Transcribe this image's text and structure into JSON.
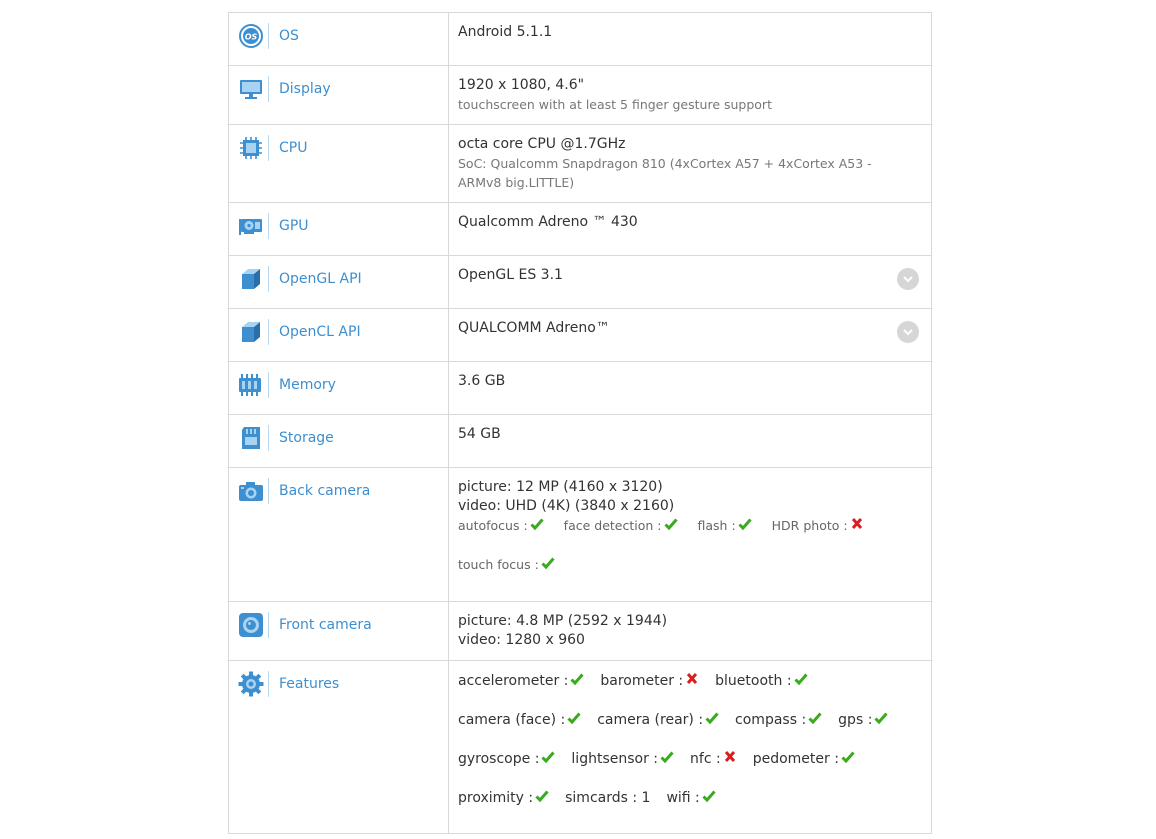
{
  "colors": {
    "label": "#3d8fd0",
    "check": "#3aaa1e",
    "cross": "#d81e1e",
    "border": "#d9d9d9"
  },
  "rows": [
    {
      "label": "OS",
      "icon": "os-icon",
      "main": [
        "Android 5.1.1"
      ]
    },
    {
      "label": "Display",
      "icon": "monitor-icon",
      "main": [
        "1920 x 1080, 4.6\""
      ],
      "sub": "touchscreen with at least 5 finger gesture support"
    },
    {
      "label": "CPU",
      "icon": "chip-icon",
      "main": [
        "octa core CPU @1.7GHz"
      ],
      "sub": "SoC: Qualcomm Snapdragon 810 (4xCortex A57 + 4xCortex A53 - ARMv8 big.LITTLE)"
    },
    {
      "label": "GPU",
      "icon": "gpu-card-icon",
      "main": [
        "Qualcomm Adreno ™ 430"
      ]
    },
    {
      "label": "OpenGL API",
      "icon": "cube-icon",
      "main": [
        "OpenGL ES 3.1"
      ]
    },
    {
      "label": "OpenCL API",
      "icon": "cube-icon",
      "main": [
        "QUALCOMM Adreno™"
      ]
    },
    {
      "label": "Memory",
      "icon": "ram-icon",
      "main": [
        "3.6 GB"
      ]
    },
    {
      "label": "Storage",
      "icon": "sd-card-icon",
      "main": [
        "54 GB"
      ]
    },
    {
      "label": "Back camera",
      "icon": "camera-icon",
      "main": [
        "picture: 12 MP (4160 x 3120)",
        "video: UHD (4K) (3840 x 2160)"
      ],
      "flags": [
        [
          {
            "name": "autofocus :",
            "ok": true
          },
          {
            "name": "face detection :",
            "ok": true
          },
          {
            "name": "flash :",
            "ok": true
          },
          {
            "name": "HDR photo :",
            "ok": false
          }
        ],
        [
          {
            "name": "touch focus :",
            "ok": true
          }
        ]
      ]
    },
    {
      "label": "Front camera",
      "icon": "front-camera-icon",
      "main": [
        "picture: 4.8 MP (2592 x 1944)",
        "video: 1280 x 960"
      ]
    },
    {
      "label": "Features",
      "icon": "gear-icon",
      "features": [
        [
          {
            "name": "accelerometer :",
            "ok": true
          },
          {
            "name": "barometer :",
            "ok": false
          },
          {
            "name": "bluetooth :",
            "ok": true
          }
        ],
        [
          {
            "name": "camera (face) :",
            "ok": true
          },
          {
            "name": "camera (rear) :",
            "ok": true
          },
          {
            "name": "compass :",
            "ok": true
          },
          {
            "name": "gps :",
            "ok": true
          }
        ],
        [
          {
            "name": "gyroscope :",
            "ok": true
          },
          {
            "name": "lightsensor :",
            "ok": true
          },
          {
            "name": "nfc :",
            "ok": false
          },
          {
            "name": "pedometer :",
            "ok": true
          }
        ],
        [
          {
            "name": "proximity :",
            "ok": true
          },
          {
            "name": "simcards : 1"
          },
          {
            "name": "wifi :",
            "ok": true
          }
        ]
      ]
    }
  ]
}
